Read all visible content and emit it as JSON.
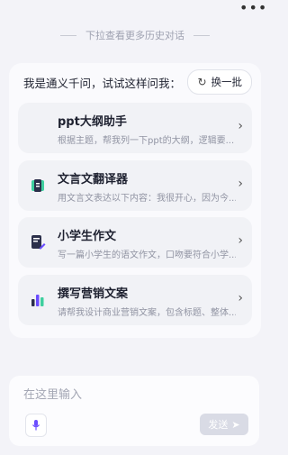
{
  "top": {
    "more_icon": "more-dots-icon"
  },
  "history_hint": "下拉查看更多历史对话",
  "intro": {
    "text": "我是通义千问，试试这样问我：",
    "refresh_label": "换一批",
    "refresh_icon": "refresh-icon"
  },
  "prompts": [
    {
      "title": "ppt大纲助手",
      "desc": "根据主题，帮我列一下ppt的大纲，逻辑要...",
      "icon": "none"
    },
    {
      "title": "文言文翻译器",
      "desc": "用文言文表达以下内容：我很开心，因为今...",
      "icon": "book-icon",
      "color": "#3ecf9f"
    },
    {
      "title": "小学生作文",
      "desc": "写一篇小学生的语文作文，口吻要符合小学...",
      "icon": "essay-icon",
      "color": "#6a4cff"
    },
    {
      "title": "撰写营销文案",
      "desc": "请帮我设计商业营销文案，包含标题、整体...",
      "icon": "bar-chart-icon",
      "color": "#6a4cff"
    }
  ],
  "input": {
    "placeholder": "在这里输入",
    "mic_icon": "microphone-icon",
    "send_label": "发送",
    "send_icon": "paper-plane-icon"
  }
}
